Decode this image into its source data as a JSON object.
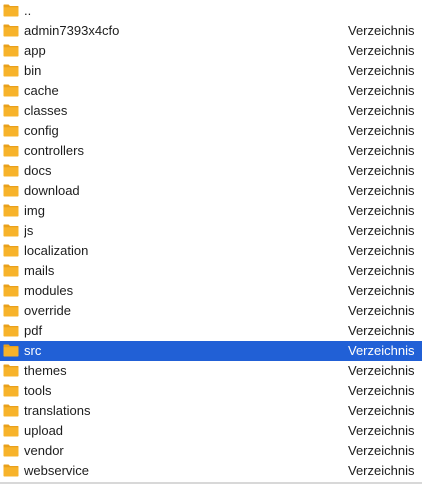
{
  "file_list": {
    "folder_color": "#f7b32b",
    "folder_tab_color": "#e9a11c",
    "selection_color": "#2160d6",
    "rows": [
      {
        "name": "..",
        "kind": "",
        "selected": false
      },
      {
        "name": "admin7393x4cfo",
        "kind": "Verzeichnis",
        "selected": false
      },
      {
        "name": "app",
        "kind": "Verzeichnis",
        "selected": false
      },
      {
        "name": "bin",
        "kind": "Verzeichnis",
        "selected": false
      },
      {
        "name": "cache",
        "kind": "Verzeichnis",
        "selected": false
      },
      {
        "name": "classes",
        "kind": "Verzeichnis",
        "selected": false
      },
      {
        "name": "config",
        "kind": "Verzeichnis",
        "selected": false
      },
      {
        "name": "controllers",
        "kind": "Verzeichnis",
        "selected": false
      },
      {
        "name": "docs",
        "kind": "Verzeichnis",
        "selected": false
      },
      {
        "name": "download",
        "kind": "Verzeichnis",
        "selected": false
      },
      {
        "name": "img",
        "kind": "Verzeichnis",
        "selected": false
      },
      {
        "name": "js",
        "kind": "Verzeichnis",
        "selected": false
      },
      {
        "name": "localization",
        "kind": "Verzeichnis",
        "selected": false
      },
      {
        "name": "mails",
        "kind": "Verzeichnis",
        "selected": false
      },
      {
        "name": "modules",
        "kind": "Verzeichnis",
        "selected": false
      },
      {
        "name": "override",
        "kind": "Verzeichnis",
        "selected": false
      },
      {
        "name": "pdf",
        "kind": "Verzeichnis",
        "selected": false
      },
      {
        "name": "src",
        "kind": "Verzeichnis",
        "selected": true
      },
      {
        "name": "themes",
        "kind": "Verzeichnis",
        "selected": false
      },
      {
        "name": "tools",
        "kind": "Verzeichnis",
        "selected": false
      },
      {
        "name": "translations",
        "kind": "Verzeichnis",
        "selected": false
      },
      {
        "name": "upload",
        "kind": "Verzeichnis",
        "selected": false
      },
      {
        "name": "vendor",
        "kind": "Verzeichnis",
        "selected": false
      },
      {
        "name": "webservice",
        "kind": "Verzeichnis",
        "selected": false
      }
    ]
  }
}
